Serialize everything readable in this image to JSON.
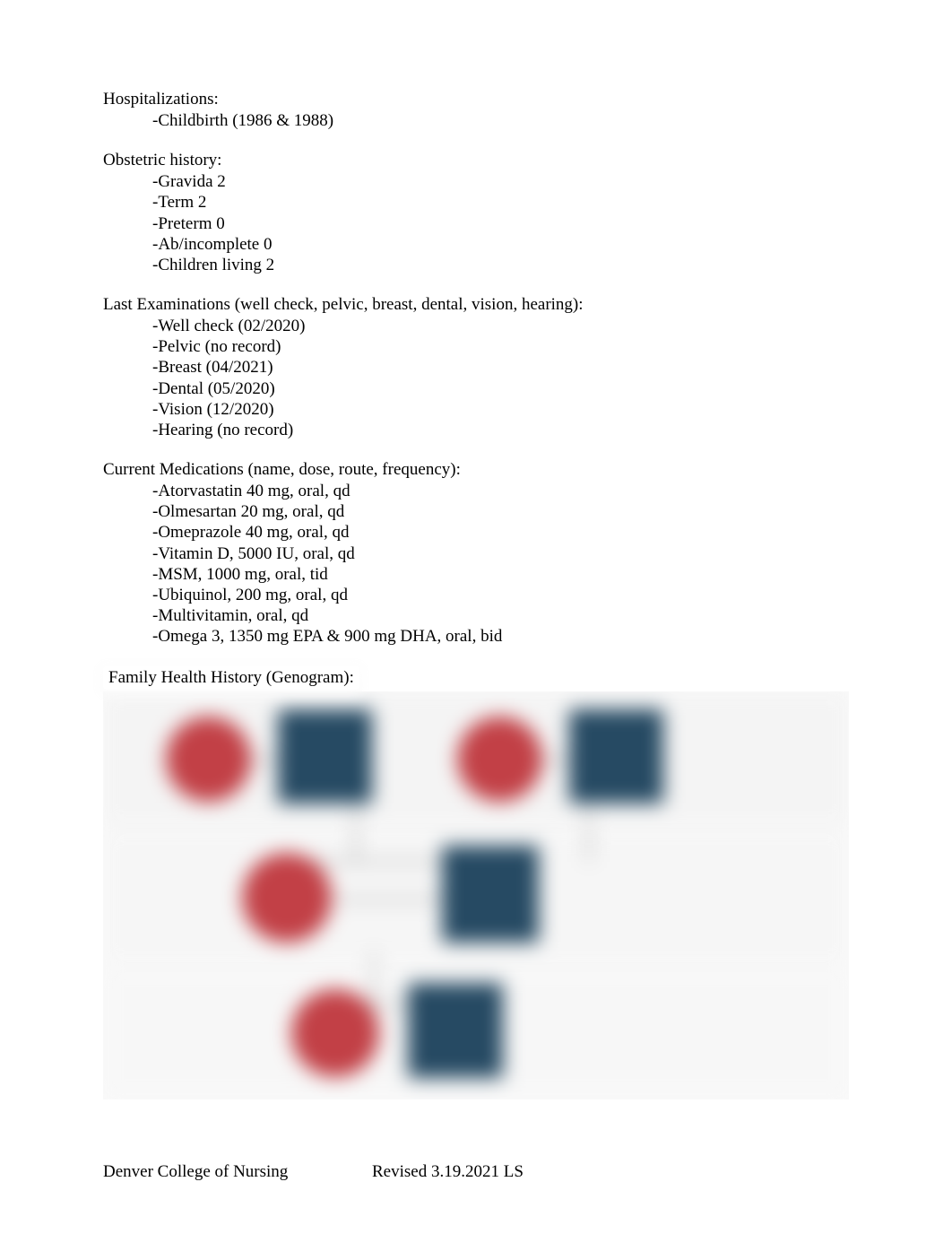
{
  "sections": {
    "hospitalizations": {
      "title": "Hospitalizations:",
      "items": [
        "-Childbirth (1986 & 1988)"
      ]
    },
    "obstetric": {
      "title": "Obstetric history:",
      "items": [
        "-Gravida 2",
        "-Term 2",
        "-Preterm 0",
        "-Ab/incomplete 0",
        "-Children living 2"
      ]
    },
    "lastExams": {
      "title": "Last Examinations (well check, pelvic, breast, dental, vision, hearing):",
      "items": [
        "-Well check (02/2020)",
        "-Pelvic (no record)",
        "-Breast (04/2021)",
        "-Dental (05/2020)",
        "-Vision (12/2020)",
        "-Hearing (no record)"
      ]
    },
    "medications": {
      "title": "Current Medications (name, dose, route, frequency):",
      "items": [
        "-Atorvastatin 40 mg, oral, qd",
        "-Olmesartan 20 mg, oral, qd",
        "-Omeprazole 40 mg, oral, qd",
        "-Vitamin D, 5000 IU, oral, qd",
        "-MSM, 1000 mg, oral, tid",
        "-Ubiquinol, 200 mg, oral, qd",
        "-Multivitamin, oral, qd",
        "-Omega 3, 1350 mg EPA & 900 mg DHA, oral, bid"
      ]
    },
    "family": {
      "title": "Family Health History (Genogram):"
    }
  },
  "genogram": {
    "colors": {
      "female": "#c24046",
      "male": "#264a63",
      "band": "#f4f4f4",
      "line": "#bdbdbd"
    }
  },
  "footer": {
    "left": "Denver College of Nursing",
    "right": "Revised 3.19.2021 LS"
  }
}
